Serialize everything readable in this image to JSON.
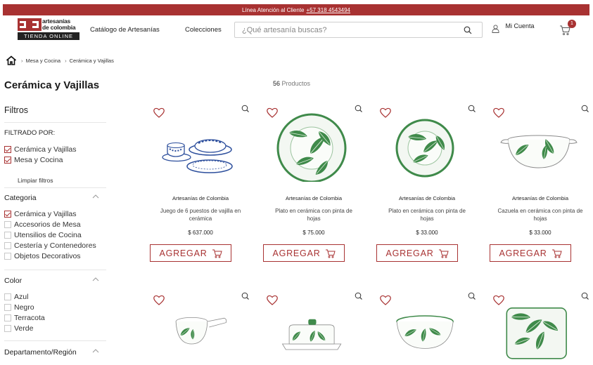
{
  "topbar": {
    "text": "Línea Atención al Cliente",
    "phone": "+57 318 4543494"
  },
  "logo": {
    "line1": "artesanías",
    "line2": "de colombia",
    "band": "TIENDA ONLINE"
  },
  "nav": {
    "catalog": "Catálogo de Artesanías",
    "collections": "Colecciones"
  },
  "search": {
    "placeholder": "¿Qué artesanía buscas?"
  },
  "account": {
    "label": "Mi Cuenta"
  },
  "cart": {
    "count": "1"
  },
  "breadcrumb": {
    "items": [
      "Mesa y Cocina",
      "Cerámica y Vajillas"
    ]
  },
  "page": {
    "title": "Cerámica y Vajillas",
    "count_number": "56",
    "count_label": "Productos"
  },
  "sidebar": {
    "filters_heading": "Filtros",
    "filtered_by": "FILTRADO POR:",
    "active_filters": [
      "Cerámica y Vajillas",
      "Mesa y Cocina"
    ],
    "clear": "Limpiar filtros",
    "category": {
      "heading": "Categoria",
      "options": [
        "Cerámica y Vajillas",
        "Accesorios de Mesa",
        "Utensilios de Cocina",
        "Cestería y Contenedores",
        "Objetos Decorativos"
      ],
      "checked": [
        true,
        false,
        false,
        false,
        false
      ]
    },
    "color": {
      "heading": "Color",
      "options": [
        "Azul",
        "Negro",
        "Terracota",
        "Verde"
      ]
    },
    "region": {
      "heading": "Departamento/Región"
    }
  },
  "products": [
    {
      "brand": "Artesanías de Colombia",
      "name": "Juego de 6 puestos de vajilla en cerámica",
      "price": "$ 637.000",
      "button": "AGREGAR",
      "image": "blue-tableware-set"
    },
    {
      "brand": "Artesanías de Colombia",
      "name": "Plato en cerámica con pinta de hojas",
      "price": "$ 75.000",
      "button": "AGREGAR",
      "image": "leaf-plate-large"
    },
    {
      "brand": "Artesanías de Colombia",
      "name": "Plato en cerámica con pinta de hojas",
      "price": "$ 33.000",
      "button": "AGREGAR",
      "image": "leaf-plate-small"
    },
    {
      "brand": "Artesanías de Colombia",
      "name": "Cazuela en cerámica con pinta de hojas",
      "price": "$ 33.000",
      "button": "AGREGAR",
      "image": "leaf-casserole"
    },
    {
      "image": "leaf-saucepan"
    },
    {
      "image": "leaf-butter-dish"
    },
    {
      "image": "leaf-bowl"
    },
    {
      "image": "leaf-square-plate"
    }
  ],
  "colors": {
    "accent": "#a83232",
    "leaf": "#3f8a4a",
    "blue": "#2c4e9c"
  }
}
